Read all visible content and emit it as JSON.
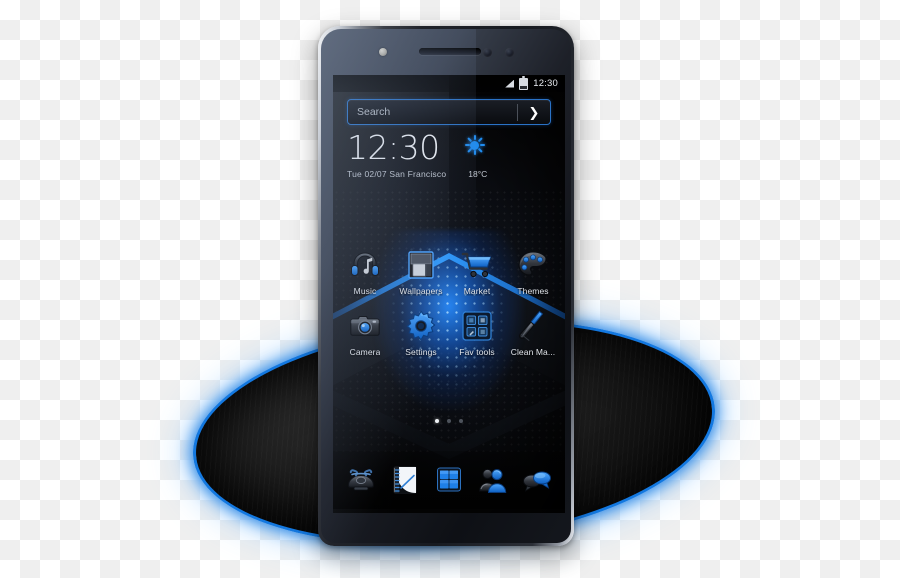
{
  "scene": {
    "title": "Blue Tech Launcher Theme Preview",
    "accent_color": "#1378e0",
    "pedestal_outline_color": "#1378e0",
    "background": "transparent-checkerboard"
  },
  "phone": {
    "device_label": "smartphone-mockup",
    "bezel_color": "#20232a",
    "hardware": {
      "earpiece": "earpiece-speaker",
      "front_camera": "front-camera",
      "sensors": [
        "proximity-sensor",
        "light-sensor"
      ]
    }
  },
  "status_bar": {
    "signal_icon": "signal-icon",
    "battery_icon": "battery-icon",
    "time": "12:30"
  },
  "search": {
    "placeholder": "Search",
    "value": "Search",
    "go_icon": "chevron-right-icon",
    "go_glyph": "❯",
    "border_color": "#2a72c6"
  },
  "clock_widget": {
    "time": "12:30",
    "date": "Tue  02/07",
    "location": "San Francisco",
    "date_line": "Tue  02/07  San Francisco",
    "weather_icon": "sun-icon",
    "temperature": "18°C"
  },
  "home": {
    "rows": [
      {
        "apps": [
          {
            "label": "Music",
            "icon": "music-headphones-icon"
          },
          {
            "label": "Wallpapers",
            "icon": "wallpaper-picture-icon"
          },
          {
            "label": "Market",
            "icon": "shopping-cart-icon"
          },
          {
            "label": "Themes",
            "icon": "paint-palette-icon"
          }
        ]
      },
      {
        "apps": [
          {
            "label": "Camera",
            "icon": "camera-icon"
          },
          {
            "label": "Settings",
            "icon": "gear-icon"
          },
          {
            "label": "Fav tools",
            "icon": "folder-tools-icon"
          },
          {
            "label": "Clean Ma...",
            "icon": "broom-clean-icon"
          }
        ]
      }
    ],
    "page_indicator": {
      "total": 3,
      "active": 1
    }
  },
  "dock": {
    "items": [
      {
        "label": "Phone",
        "icon": "telephone-icon"
      },
      {
        "label": "Notes",
        "icon": "notebook-icon"
      },
      {
        "label": "App drawer",
        "icon": "app-grid-icon"
      },
      {
        "label": "Contacts",
        "icon": "contacts-people-icon"
      },
      {
        "label": "Messages",
        "icon": "messages-icon"
      }
    ]
  }
}
